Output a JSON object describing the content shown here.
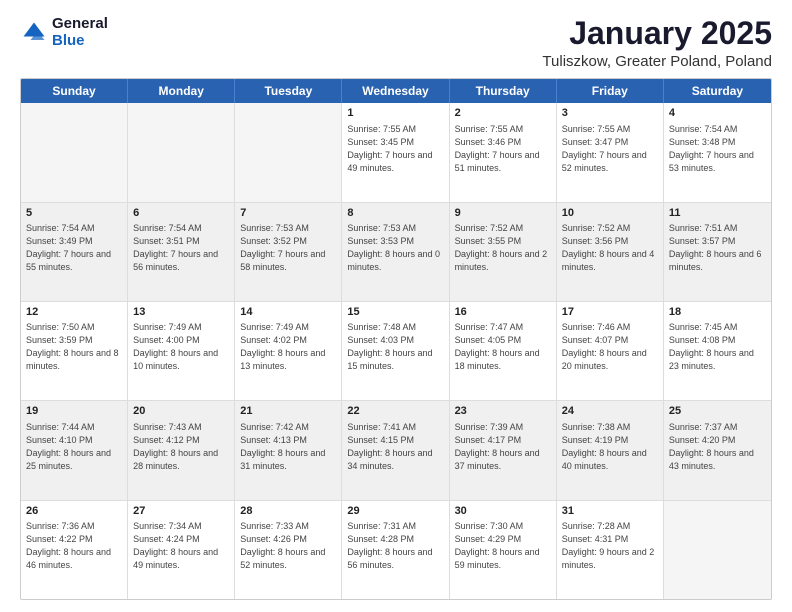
{
  "logo": {
    "general": "General",
    "blue": "Blue"
  },
  "title": "January 2025",
  "subtitle": "Tuliszkow, Greater Poland, Poland",
  "days": [
    "Sunday",
    "Monday",
    "Tuesday",
    "Wednesday",
    "Thursday",
    "Friday",
    "Saturday"
  ],
  "weeks": [
    [
      {
        "day": "",
        "sunrise": "",
        "sunset": "",
        "daylight": "",
        "empty": true
      },
      {
        "day": "",
        "sunrise": "",
        "sunset": "",
        "daylight": "",
        "empty": true
      },
      {
        "day": "",
        "sunrise": "",
        "sunset": "",
        "daylight": "",
        "empty": true
      },
      {
        "day": "1",
        "sunrise": "Sunrise: 7:55 AM",
        "sunset": "Sunset: 3:45 PM",
        "daylight": "Daylight: 7 hours and 49 minutes.",
        "empty": false
      },
      {
        "day": "2",
        "sunrise": "Sunrise: 7:55 AM",
        "sunset": "Sunset: 3:46 PM",
        "daylight": "Daylight: 7 hours and 51 minutes.",
        "empty": false
      },
      {
        "day": "3",
        "sunrise": "Sunrise: 7:55 AM",
        "sunset": "Sunset: 3:47 PM",
        "daylight": "Daylight: 7 hours and 52 minutes.",
        "empty": false
      },
      {
        "day": "4",
        "sunrise": "Sunrise: 7:54 AM",
        "sunset": "Sunset: 3:48 PM",
        "daylight": "Daylight: 7 hours and 53 minutes.",
        "empty": false
      }
    ],
    [
      {
        "day": "5",
        "sunrise": "Sunrise: 7:54 AM",
        "sunset": "Sunset: 3:49 PM",
        "daylight": "Daylight: 7 hours and 55 minutes.",
        "empty": false
      },
      {
        "day": "6",
        "sunrise": "Sunrise: 7:54 AM",
        "sunset": "Sunset: 3:51 PM",
        "daylight": "Daylight: 7 hours and 56 minutes.",
        "empty": false
      },
      {
        "day": "7",
        "sunrise": "Sunrise: 7:53 AM",
        "sunset": "Sunset: 3:52 PM",
        "daylight": "Daylight: 7 hours and 58 minutes.",
        "empty": false
      },
      {
        "day": "8",
        "sunrise": "Sunrise: 7:53 AM",
        "sunset": "Sunset: 3:53 PM",
        "daylight": "Daylight: 8 hours and 0 minutes.",
        "empty": false
      },
      {
        "day": "9",
        "sunrise": "Sunrise: 7:52 AM",
        "sunset": "Sunset: 3:55 PM",
        "daylight": "Daylight: 8 hours and 2 minutes.",
        "empty": false
      },
      {
        "day": "10",
        "sunrise": "Sunrise: 7:52 AM",
        "sunset": "Sunset: 3:56 PM",
        "daylight": "Daylight: 8 hours and 4 minutes.",
        "empty": false
      },
      {
        "day": "11",
        "sunrise": "Sunrise: 7:51 AM",
        "sunset": "Sunset: 3:57 PM",
        "daylight": "Daylight: 8 hours and 6 minutes.",
        "empty": false
      }
    ],
    [
      {
        "day": "12",
        "sunrise": "Sunrise: 7:50 AM",
        "sunset": "Sunset: 3:59 PM",
        "daylight": "Daylight: 8 hours and 8 minutes.",
        "empty": false
      },
      {
        "day": "13",
        "sunrise": "Sunrise: 7:49 AM",
        "sunset": "Sunset: 4:00 PM",
        "daylight": "Daylight: 8 hours and 10 minutes.",
        "empty": false
      },
      {
        "day": "14",
        "sunrise": "Sunrise: 7:49 AM",
        "sunset": "Sunset: 4:02 PM",
        "daylight": "Daylight: 8 hours and 13 minutes.",
        "empty": false
      },
      {
        "day": "15",
        "sunrise": "Sunrise: 7:48 AM",
        "sunset": "Sunset: 4:03 PM",
        "daylight": "Daylight: 8 hours and 15 minutes.",
        "empty": false
      },
      {
        "day": "16",
        "sunrise": "Sunrise: 7:47 AM",
        "sunset": "Sunset: 4:05 PM",
        "daylight": "Daylight: 8 hours and 18 minutes.",
        "empty": false
      },
      {
        "day": "17",
        "sunrise": "Sunrise: 7:46 AM",
        "sunset": "Sunset: 4:07 PM",
        "daylight": "Daylight: 8 hours and 20 minutes.",
        "empty": false
      },
      {
        "day": "18",
        "sunrise": "Sunrise: 7:45 AM",
        "sunset": "Sunset: 4:08 PM",
        "daylight": "Daylight: 8 hours and 23 minutes.",
        "empty": false
      }
    ],
    [
      {
        "day": "19",
        "sunrise": "Sunrise: 7:44 AM",
        "sunset": "Sunset: 4:10 PM",
        "daylight": "Daylight: 8 hours and 25 minutes.",
        "empty": false
      },
      {
        "day": "20",
        "sunrise": "Sunrise: 7:43 AM",
        "sunset": "Sunset: 4:12 PM",
        "daylight": "Daylight: 8 hours and 28 minutes.",
        "empty": false
      },
      {
        "day": "21",
        "sunrise": "Sunrise: 7:42 AM",
        "sunset": "Sunset: 4:13 PM",
        "daylight": "Daylight: 8 hours and 31 minutes.",
        "empty": false
      },
      {
        "day": "22",
        "sunrise": "Sunrise: 7:41 AM",
        "sunset": "Sunset: 4:15 PM",
        "daylight": "Daylight: 8 hours and 34 minutes.",
        "empty": false
      },
      {
        "day": "23",
        "sunrise": "Sunrise: 7:39 AM",
        "sunset": "Sunset: 4:17 PM",
        "daylight": "Daylight: 8 hours and 37 minutes.",
        "empty": false
      },
      {
        "day": "24",
        "sunrise": "Sunrise: 7:38 AM",
        "sunset": "Sunset: 4:19 PM",
        "daylight": "Daylight: 8 hours and 40 minutes.",
        "empty": false
      },
      {
        "day": "25",
        "sunrise": "Sunrise: 7:37 AM",
        "sunset": "Sunset: 4:20 PM",
        "daylight": "Daylight: 8 hours and 43 minutes.",
        "empty": false
      }
    ],
    [
      {
        "day": "26",
        "sunrise": "Sunrise: 7:36 AM",
        "sunset": "Sunset: 4:22 PM",
        "daylight": "Daylight: 8 hours and 46 minutes.",
        "empty": false
      },
      {
        "day": "27",
        "sunrise": "Sunrise: 7:34 AM",
        "sunset": "Sunset: 4:24 PM",
        "daylight": "Daylight: 8 hours and 49 minutes.",
        "empty": false
      },
      {
        "day": "28",
        "sunrise": "Sunrise: 7:33 AM",
        "sunset": "Sunset: 4:26 PM",
        "daylight": "Daylight: 8 hours and 52 minutes.",
        "empty": false
      },
      {
        "day": "29",
        "sunrise": "Sunrise: 7:31 AM",
        "sunset": "Sunset: 4:28 PM",
        "daylight": "Daylight: 8 hours and 56 minutes.",
        "empty": false
      },
      {
        "day": "30",
        "sunrise": "Sunrise: 7:30 AM",
        "sunset": "Sunset: 4:29 PM",
        "daylight": "Daylight: 8 hours and 59 minutes.",
        "empty": false
      },
      {
        "day": "31",
        "sunrise": "Sunrise: 7:28 AM",
        "sunset": "Sunset: 4:31 PM",
        "daylight": "Daylight: 9 hours and 2 minutes.",
        "empty": false
      },
      {
        "day": "",
        "sunrise": "",
        "sunset": "",
        "daylight": "",
        "empty": true
      }
    ]
  ]
}
